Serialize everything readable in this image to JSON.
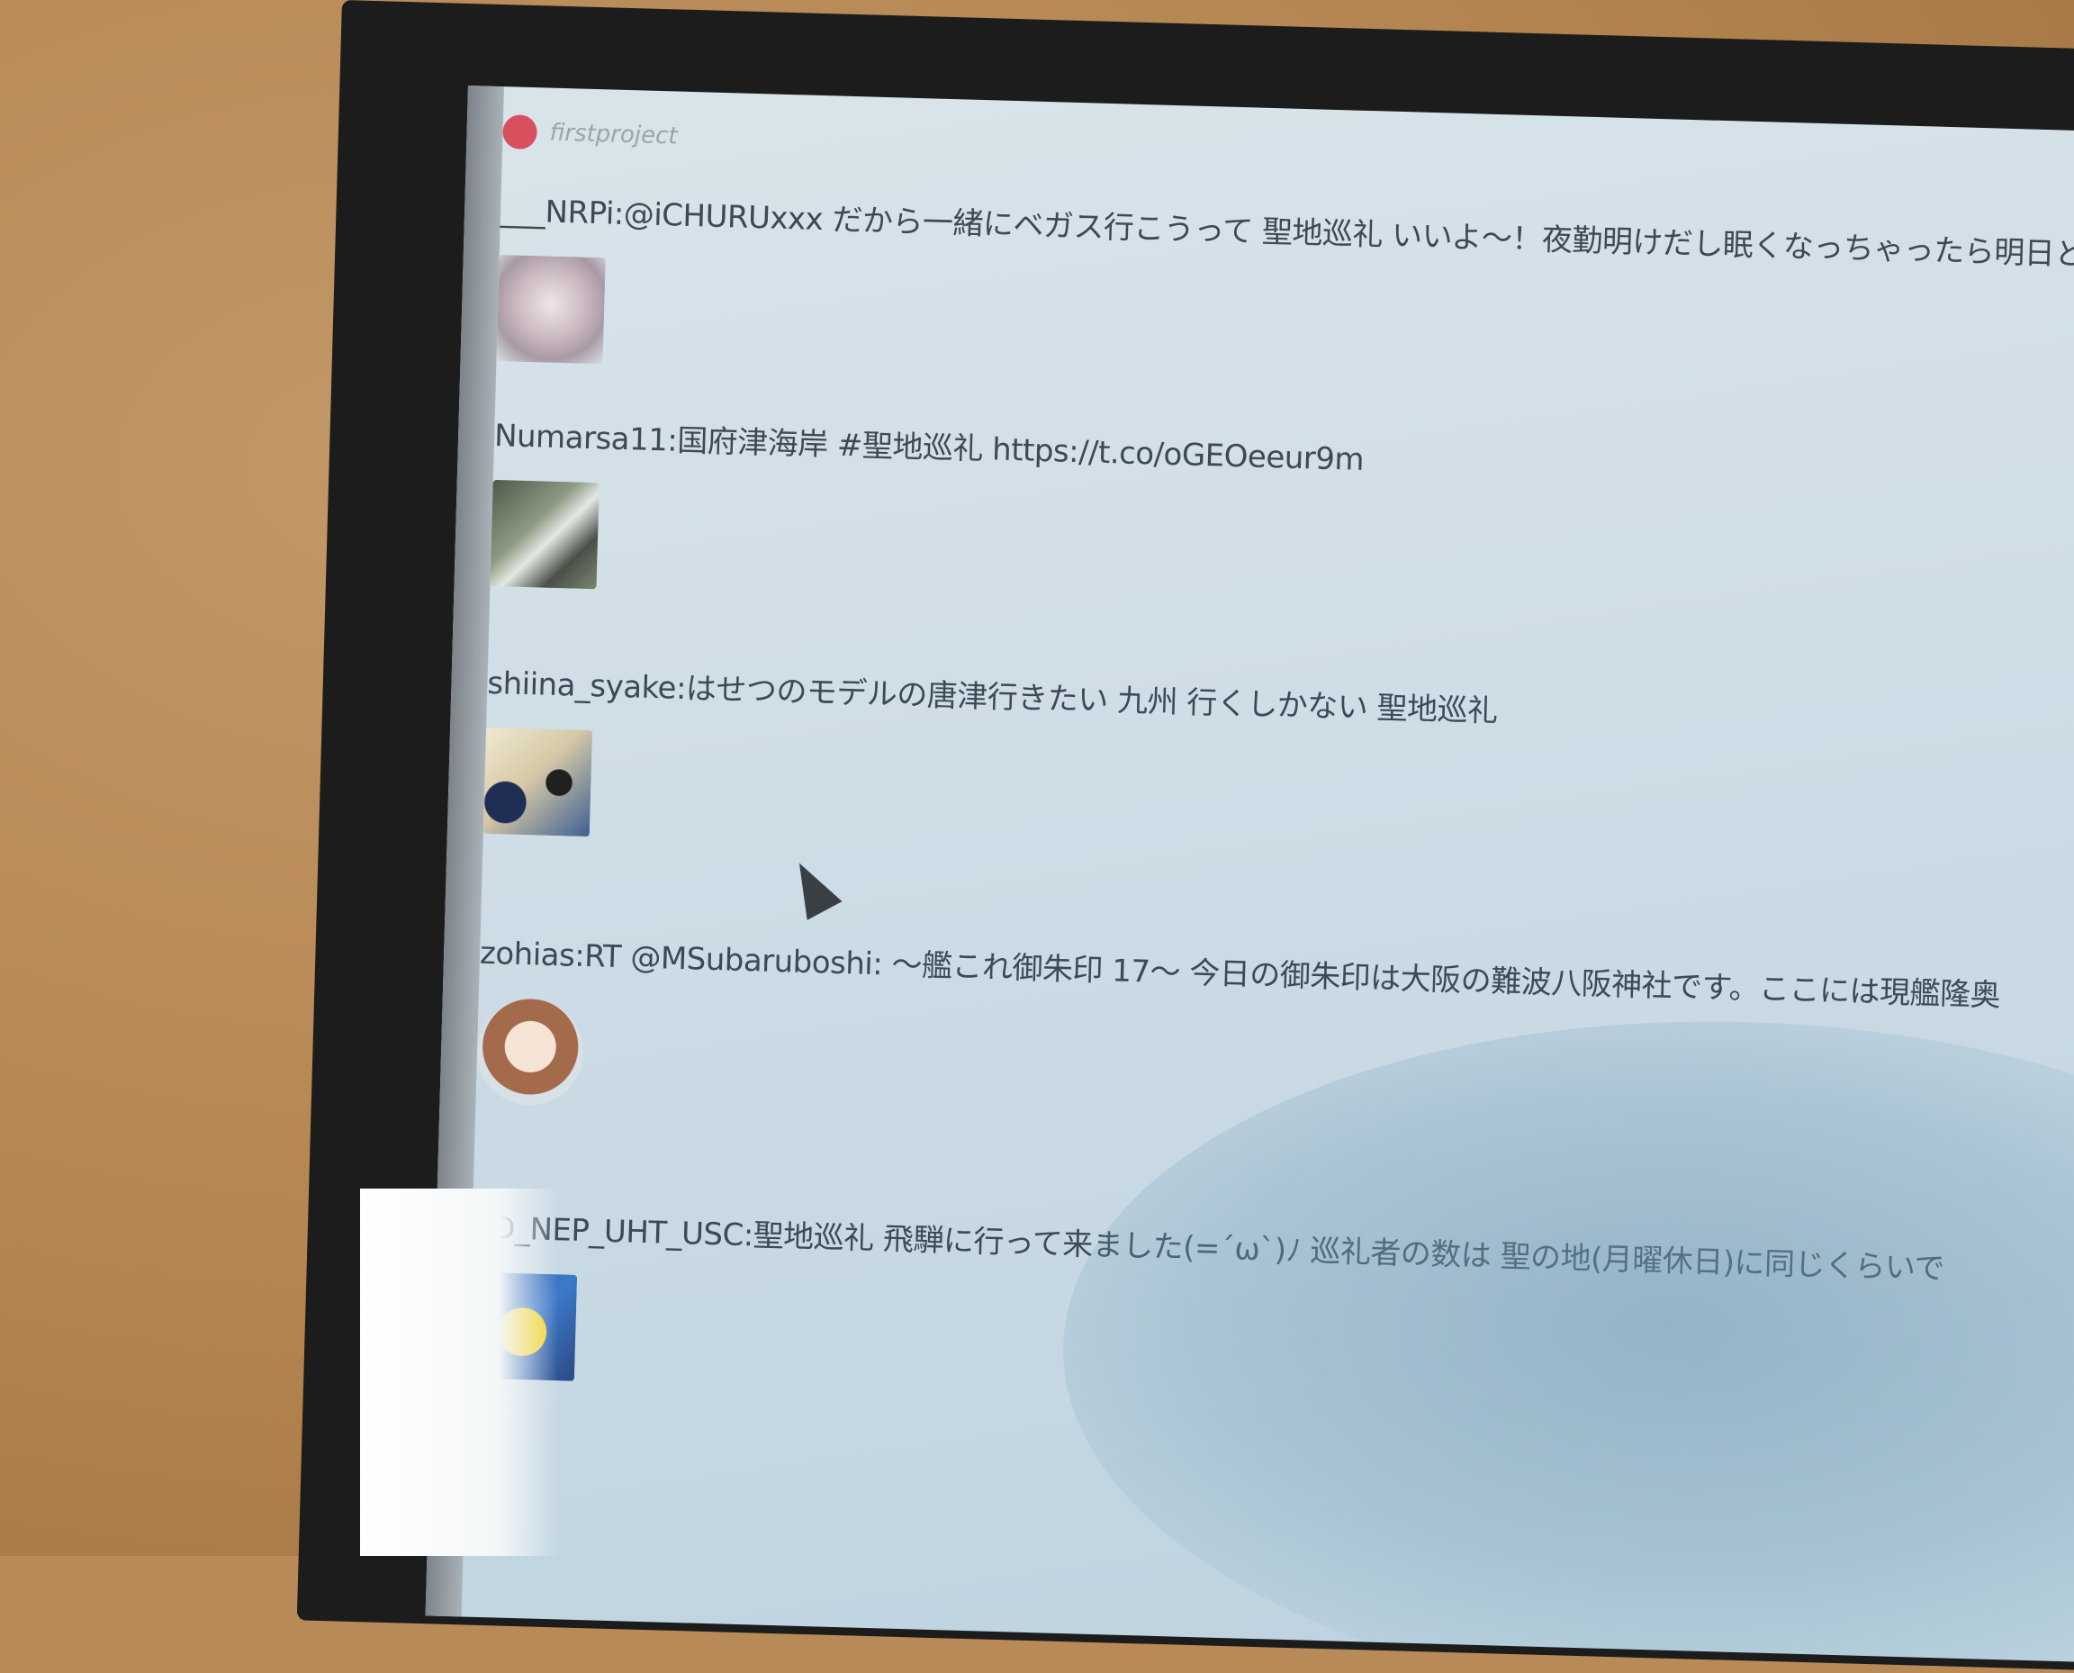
{
  "app": {
    "title": "firstproject"
  },
  "timeline": {
    "tweets": [
      {
        "text": "___NRPi:@iCHURUxxx だから一緒にベガス行こうって 聖地巡礼 いいよ～！夜勤明けだし眠くなっちゃったら明日とか明後日と",
        "avatar_icon": "anime-avatar-icon"
      },
      {
        "text": "Numarsa11:国府津海岸 #聖地巡礼 https://t.co/oGEOeeur9m",
        "avatar_icon": "photo-avatar-icon"
      },
      {
        "text": "shiina_syake:はせつのモデルの唐津行きたい 九州 行くしかない 聖地巡礼",
        "avatar_icon": "anime-avatar-icon"
      },
      {
        "text": "zohias:RT @MSubaruboshi: ～艦これ御朱印 17～ 今日の御朱印は大阪の難波八阪神社です。ここには現艦隆奥",
        "avatar_icon": "anime-girl-avatar-icon"
      },
      {
        "text": "KD_NEP_UHT_USC:聖地巡礼 飛騨に行って来ました(=´ω`)ﾉ 巡礼者の数は 聖の地(月曜休日)に同じくらいで",
        "avatar_icon": "pokemon-avatar-icon"
      }
    ]
  },
  "colors": {
    "app_icon": "#d8505e",
    "text": "#3b4a55",
    "screen_bg": "#cfdde6"
  }
}
